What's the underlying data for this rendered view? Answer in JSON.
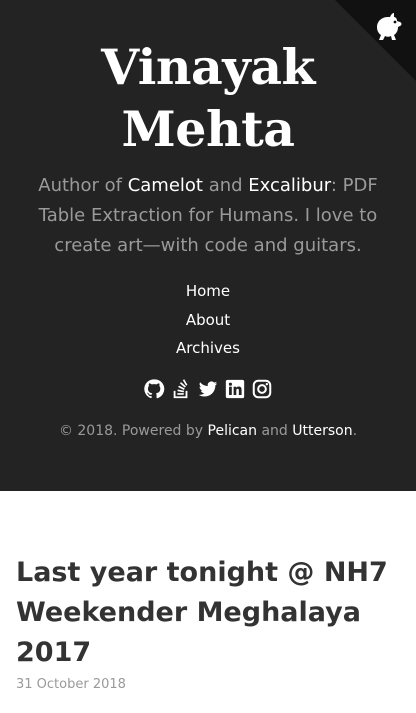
{
  "sidebar": {
    "title": "Vinayak Mehta",
    "tagline": {
      "prefix": "Author of ",
      "link1": "Camelot",
      "middle": " and ",
      "link2": "Excalibur",
      "suffix": ": PDF Table Extraction for Humans. I love to create art—with code and guitars."
    },
    "nav": [
      "Home",
      "About",
      "Archives"
    ],
    "social_icons": [
      "github-icon",
      "stackoverflow-icon",
      "twitter-icon",
      "linkedin-icon",
      "instagram-icon"
    ],
    "copyright": {
      "prefix": "© 2018. Powered by ",
      "link1": "Pelican",
      "middle": " and ",
      "link2": "Utterson",
      "suffix": "."
    },
    "corner_icon": "fork-icon"
  },
  "post": {
    "title": "Last year tonight @ NH7 Weekender Meghalaya 2017",
    "date": "31 October 2018"
  },
  "colors": {
    "sidebar_bg": "#232323",
    "corner_bg": "#111111",
    "text_muted": "#9a9a9a",
    "link": "#ffffff",
    "post_title": "#333333"
  }
}
